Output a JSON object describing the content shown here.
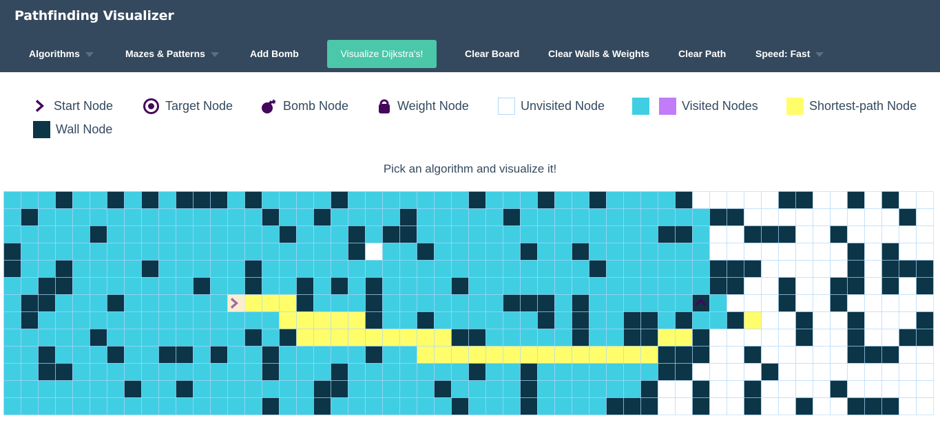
{
  "navbar": {
    "brand": "Pathfinding Visualizer",
    "algorithms": "Algorithms",
    "mazes": "Mazes & Patterns",
    "add_bomb": "Add Bomb",
    "visualize": "Visualize Dijkstra's!",
    "clear_board": "Clear Board",
    "clear_walls": "Clear Walls & Weights",
    "clear_path": "Clear Path",
    "speed": "Speed: Fast"
  },
  "legend": {
    "start": "Start Node",
    "target": "Target Node",
    "bomb": "Bomb Node",
    "weight": "Weight Node",
    "unvisited": "Unvisited Node",
    "visited": "Visited Nodes",
    "shortest": "Shortest-path Node",
    "wall": "Wall Node"
  },
  "instructions": "Pick an algorithm and visualize it!",
  "colors": {
    "navbar": "#34495e",
    "accent": "#4bc7a9",
    "visited": "#40cee3",
    "visited_alt": "#c27cf7",
    "wall": "#0c3547",
    "shortest_path": "#fffe6a",
    "node_icon": "#44075b",
    "grid_line": "#afd8f8"
  },
  "grid": {
    "rows": 13,
    "cols": 54,
    "start": [
      6,
      13
    ],
    "target": [
      6,
      40
    ],
    "cells": [
      "VVVWVVWVWVWWWVWVVVVWVVVVVVVWVVVWVVWVVVVWUUUUUWWUUWUW",
      "VWVVVVVVVVVVVVVWVVWVVVVWVVVVVWVVVVVVVVVVVWWUUUUUUUUUW",
      "VVVVVWVVVVVVVVVVWVVVWVWWVVVVVVVVVVVVVVWWVUUWWWUUWUUUU",
      "WVVVVVVVVVVVVVVVVVVVWUVVWVVVVVWVVWVVVVVVVUUUUUUUUWUWU",
      "WVVWVVVVWVVVVVWVVVVVVVVVVVVVVVVVVVWVVVVVVWWWUUUUUWUWWW",
      "VVWWVVVVVVVWVVWVVWVWVWVVVVWVVVVVVVVVVVVVVWWUUWUUWWUWUW",
      "VWWVVVWVVVVVVVSPPWVVVWVVVVVVVWWWVWVVVVVVWTUUUWUUWUUUUU",
      "VWVVVVVVVVVVVVVVPPPPPWVVWVVVVVVWVWVVWWVWVVWPUUWUUWUUUW",
      "VVVVVWVVVVVVVVWVWPPPPPPPPPWWVVVVVWVVWWPPWUUUUUWUUWUUWW",
      "VVWVVVWVVWWVWVVWVVVVVWVVPPPPPPPPPPPPPPWWWUUWUUUUUWWWU",
      "VVWWVVVVVVVVVVVWVVVWVVVVVVVWVVWVVVVVVVWWUUUUWUUUUUUUU",
      "VVVVVVVWVVWVVVVVVVWWVVVVVWVVVVWVVVVVVWUUWUUWUUUUWUUUU",
      "VVVVVVVVVVVVVVVWVVWVVVVVVVWVVVWVVVVWWWUUWUUWUUWUUWWWU"
    ]
  }
}
